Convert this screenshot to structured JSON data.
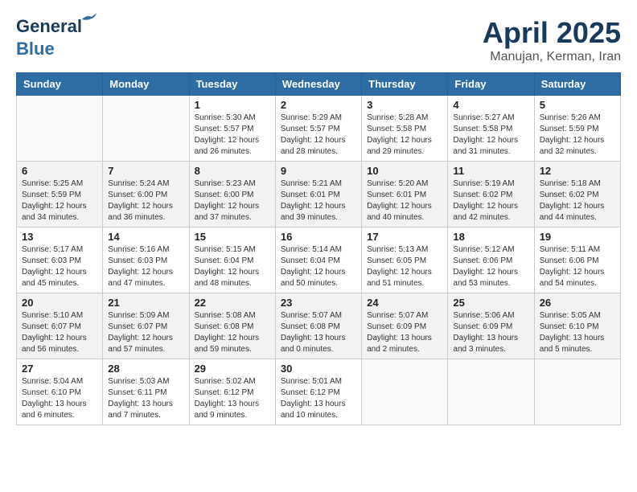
{
  "header": {
    "logo_line1": "General",
    "logo_line2": "Blue",
    "month": "April 2025",
    "location": "Manujan, Kerman, Iran"
  },
  "days_of_week": [
    "Sunday",
    "Monday",
    "Tuesday",
    "Wednesday",
    "Thursday",
    "Friday",
    "Saturday"
  ],
  "weeks": [
    [
      {
        "day": "",
        "info": ""
      },
      {
        "day": "",
        "info": ""
      },
      {
        "day": "1",
        "info": "Sunrise: 5:30 AM\nSunset: 5:57 PM\nDaylight: 12 hours and 26 minutes."
      },
      {
        "day": "2",
        "info": "Sunrise: 5:29 AM\nSunset: 5:57 PM\nDaylight: 12 hours and 28 minutes."
      },
      {
        "day": "3",
        "info": "Sunrise: 5:28 AM\nSunset: 5:58 PM\nDaylight: 12 hours and 29 minutes."
      },
      {
        "day": "4",
        "info": "Sunrise: 5:27 AM\nSunset: 5:58 PM\nDaylight: 12 hours and 31 minutes."
      },
      {
        "day": "5",
        "info": "Sunrise: 5:26 AM\nSunset: 5:59 PM\nDaylight: 12 hours and 32 minutes."
      }
    ],
    [
      {
        "day": "6",
        "info": "Sunrise: 5:25 AM\nSunset: 5:59 PM\nDaylight: 12 hours and 34 minutes."
      },
      {
        "day": "7",
        "info": "Sunrise: 5:24 AM\nSunset: 6:00 PM\nDaylight: 12 hours and 36 minutes."
      },
      {
        "day": "8",
        "info": "Sunrise: 5:23 AM\nSunset: 6:00 PM\nDaylight: 12 hours and 37 minutes."
      },
      {
        "day": "9",
        "info": "Sunrise: 5:21 AM\nSunset: 6:01 PM\nDaylight: 12 hours and 39 minutes."
      },
      {
        "day": "10",
        "info": "Sunrise: 5:20 AM\nSunset: 6:01 PM\nDaylight: 12 hours and 40 minutes."
      },
      {
        "day": "11",
        "info": "Sunrise: 5:19 AM\nSunset: 6:02 PM\nDaylight: 12 hours and 42 minutes."
      },
      {
        "day": "12",
        "info": "Sunrise: 5:18 AM\nSunset: 6:02 PM\nDaylight: 12 hours and 44 minutes."
      }
    ],
    [
      {
        "day": "13",
        "info": "Sunrise: 5:17 AM\nSunset: 6:03 PM\nDaylight: 12 hours and 45 minutes."
      },
      {
        "day": "14",
        "info": "Sunrise: 5:16 AM\nSunset: 6:03 PM\nDaylight: 12 hours and 47 minutes."
      },
      {
        "day": "15",
        "info": "Sunrise: 5:15 AM\nSunset: 6:04 PM\nDaylight: 12 hours and 48 minutes."
      },
      {
        "day": "16",
        "info": "Sunrise: 5:14 AM\nSunset: 6:04 PM\nDaylight: 12 hours and 50 minutes."
      },
      {
        "day": "17",
        "info": "Sunrise: 5:13 AM\nSunset: 6:05 PM\nDaylight: 12 hours and 51 minutes."
      },
      {
        "day": "18",
        "info": "Sunrise: 5:12 AM\nSunset: 6:06 PM\nDaylight: 12 hours and 53 minutes."
      },
      {
        "day": "19",
        "info": "Sunrise: 5:11 AM\nSunset: 6:06 PM\nDaylight: 12 hours and 54 minutes."
      }
    ],
    [
      {
        "day": "20",
        "info": "Sunrise: 5:10 AM\nSunset: 6:07 PM\nDaylight: 12 hours and 56 minutes."
      },
      {
        "day": "21",
        "info": "Sunrise: 5:09 AM\nSunset: 6:07 PM\nDaylight: 12 hours and 57 minutes."
      },
      {
        "day": "22",
        "info": "Sunrise: 5:08 AM\nSunset: 6:08 PM\nDaylight: 12 hours and 59 minutes."
      },
      {
        "day": "23",
        "info": "Sunrise: 5:07 AM\nSunset: 6:08 PM\nDaylight: 13 hours and 0 minutes."
      },
      {
        "day": "24",
        "info": "Sunrise: 5:07 AM\nSunset: 6:09 PM\nDaylight: 13 hours and 2 minutes."
      },
      {
        "day": "25",
        "info": "Sunrise: 5:06 AM\nSunset: 6:09 PM\nDaylight: 13 hours and 3 minutes."
      },
      {
        "day": "26",
        "info": "Sunrise: 5:05 AM\nSunset: 6:10 PM\nDaylight: 13 hours and 5 minutes."
      }
    ],
    [
      {
        "day": "27",
        "info": "Sunrise: 5:04 AM\nSunset: 6:10 PM\nDaylight: 13 hours and 6 minutes."
      },
      {
        "day": "28",
        "info": "Sunrise: 5:03 AM\nSunset: 6:11 PM\nDaylight: 13 hours and 7 minutes."
      },
      {
        "day": "29",
        "info": "Sunrise: 5:02 AM\nSunset: 6:12 PM\nDaylight: 13 hours and 9 minutes."
      },
      {
        "day": "30",
        "info": "Sunrise: 5:01 AM\nSunset: 6:12 PM\nDaylight: 13 hours and 10 minutes."
      },
      {
        "day": "",
        "info": ""
      },
      {
        "day": "",
        "info": ""
      },
      {
        "day": "",
        "info": ""
      }
    ]
  ]
}
